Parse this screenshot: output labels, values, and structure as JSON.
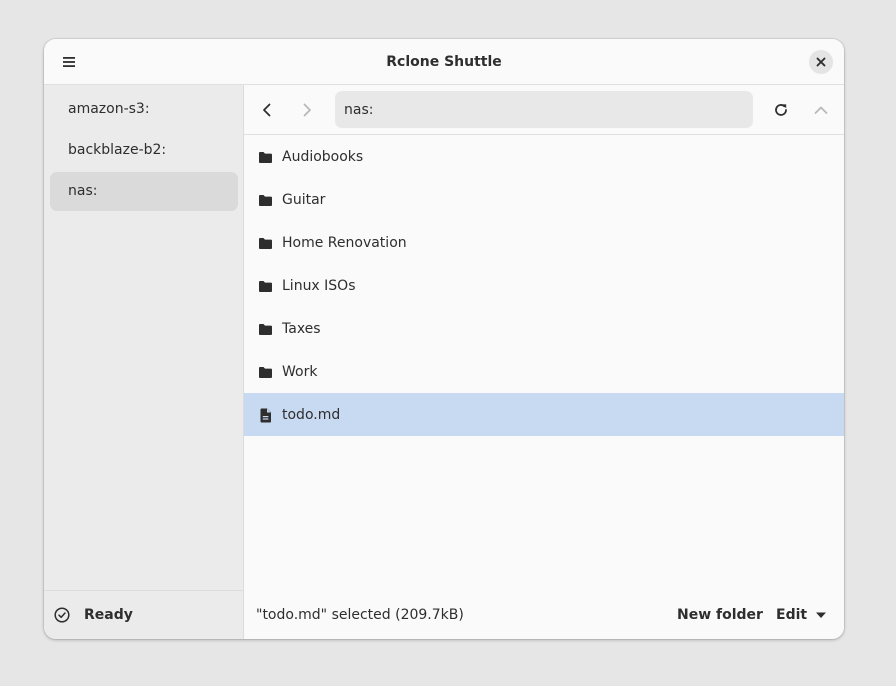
{
  "window": {
    "title": "Rclone Shuttle"
  },
  "sidebar": {
    "items": [
      {
        "label": "amazon-s3:"
      },
      {
        "label": "backblaze-b2:"
      },
      {
        "label": "nas:"
      }
    ],
    "selected_index": 2,
    "status": "Ready"
  },
  "toolbar": {
    "path_value": "nas:",
    "icons": {
      "back": "chevron-left-icon",
      "forward": "chevron-right-icon",
      "refresh": "refresh-icon",
      "up": "chevron-up-icon"
    }
  },
  "files": {
    "rows": [
      {
        "name": "Audiobooks",
        "kind": "folder"
      },
      {
        "name": "Guitar",
        "kind": "folder"
      },
      {
        "name": "Home Renovation",
        "kind": "folder"
      },
      {
        "name": "Linux ISOs",
        "kind": "folder"
      },
      {
        "name": "Taxes",
        "kind": "folder"
      },
      {
        "name": "Work",
        "kind": "folder"
      },
      {
        "name": "todo.md",
        "kind": "file"
      }
    ],
    "selected_index": 6
  },
  "statusbar": {
    "selection_text": "\"todo.md\" selected (209.7kB)",
    "new_folder_label": "New folder",
    "edit_label": "Edit"
  },
  "colors": {
    "selection": "#c8daf2",
    "sidebar_bg": "#ebebeb",
    "sidebar_selected": "#dadada",
    "window_bg": "#fafafa",
    "text": "#2e2e2e"
  }
}
